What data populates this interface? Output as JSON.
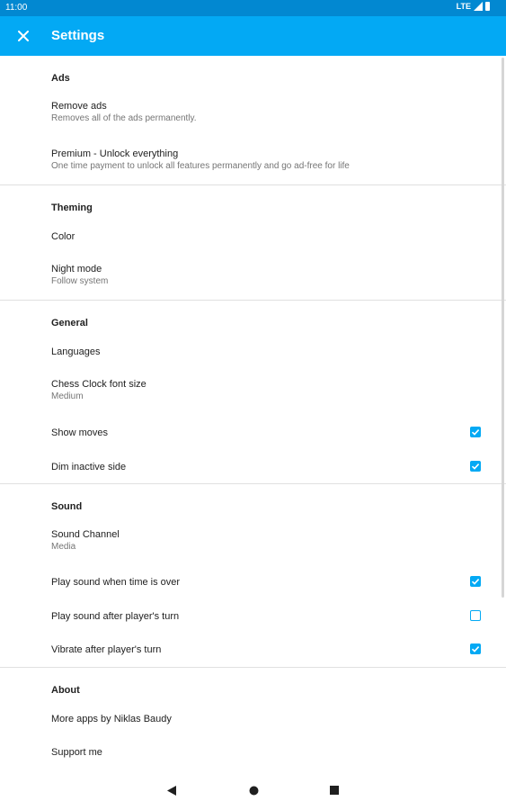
{
  "status_bar": {
    "time": "11:00",
    "network": "LTE"
  },
  "app_bar": {
    "title": "Settings"
  },
  "sections": {
    "ads": {
      "title": "Ads",
      "remove_ads": {
        "title": "Remove ads",
        "summary": "Removes all of the ads permanently."
      },
      "premium": {
        "title": "Premium - Unlock everything",
        "summary": "One time payment to unlock all features permanently and go ad-free for life"
      }
    },
    "theming": {
      "title": "Theming",
      "color": {
        "title": "Color"
      },
      "night_mode": {
        "title": "Night mode",
        "summary": "Follow system"
      }
    },
    "general": {
      "title": "General",
      "languages": {
        "title": "Languages"
      },
      "font_size": {
        "title": "Chess Clock font size",
        "summary": "Medium"
      },
      "show_moves": {
        "title": "Show moves",
        "checked": true
      },
      "dim_inactive": {
        "title": "Dim inactive side",
        "checked": true
      }
    },
    "sound": {
      "title": "Sound",
      "channel": {
        "title": "Sound Channel",
        "summary": "Media"
      },
      "time_over": {
        "title": "Play sound when time is over",
        "checked": true
      },
      "after_turn": {
        "title": "Play sound after player's turn",
        "checked": false
      },
      "vibrate": {
        "title": "Vibrate after player's turn",
        "checked": true
      }
    },
    "about": {
      "title": "About",
      "more_apps": {
        "title": "More apps by Niklas Baudy"
      },
      "support": {
        "title": "Support me"
      }
    }
  },
  "colors": {
    "primary": "#03a9f4",
    "primary_dark": "#0288d1"
  },
  "icons": {
    "close": "close-icon",
    "back": "back-triangle-icon",
    "home": "home-circle-icon",
    "recents": "recents-square-icon"
  }
}
